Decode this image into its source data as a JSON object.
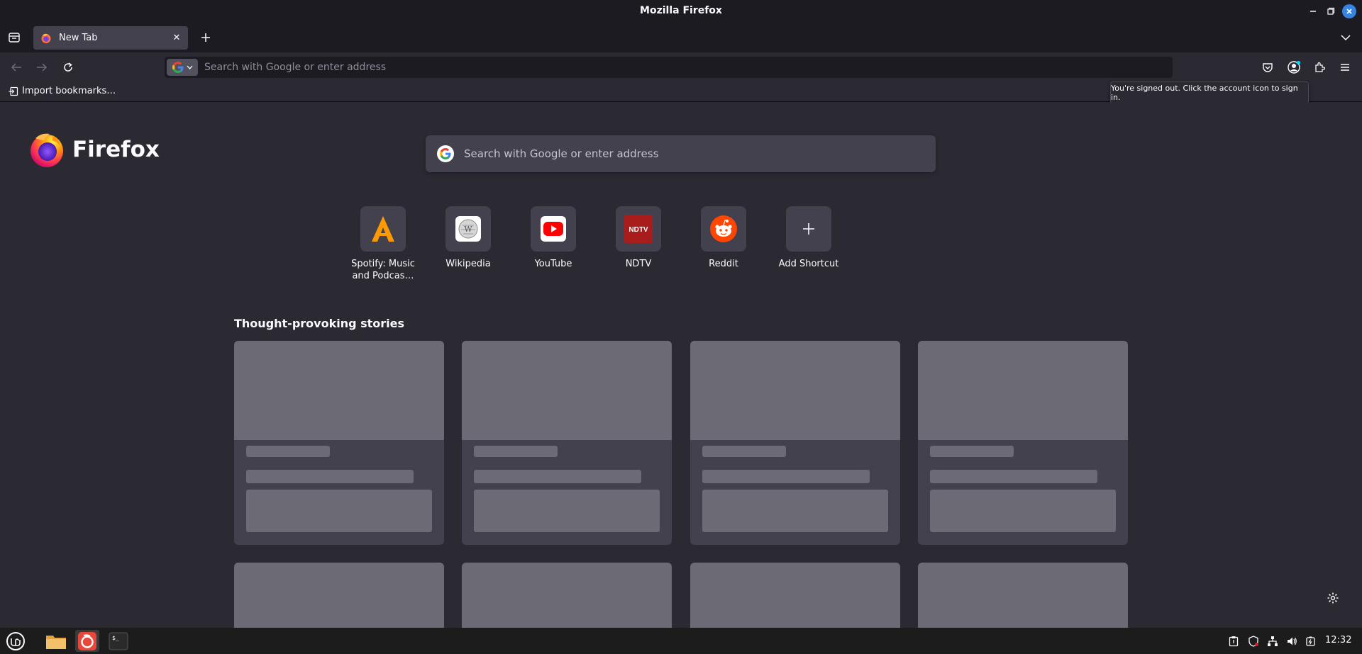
{
  "window": {
    "title": "Mozilla Firefox"
  },
  "tabs": [
    {
      "label": "New Tab",
      "close": "✕"
    }
  ],
  "urlbar": {
    "placeholder": "Search with Google or enter address"
  },
  "bookmarks_toolbar": {
    "import_label": "Import bookmarks…"
  },
  "tooltip": {
    "text": "You're signed out. Click the account icon to sign in."
  },
  "newtab": {
    "brand": "Firefox",
    "search_placeholder": "Search with Google or enter address",
    "shortcuts": [
      {
        "name": "Spotify: Music and Podcas…",
        "icon": "spotify-icon"
      },
      {
        "name": "Wikipedia",
        "icon": "wikipedia-icon"
      },
      {
        "name": "YouTube",
        "icon": "youtube-icon"
      },
      {
        "name": "NDTV",
        "icon": "ndtv-icon"
      },
      {
        "name": "Reddit",
        "icon": "reddit-icon"
      },
      {
        "name": "Add Shortcut",
        "icon": "plus-icon"
      }
    ],
    "stories_title": "Thought-provoking stories",
    "ndtv_badge": "NDTV"
  },
  "taskbar": {
    "clock": "12:32"
  },
  "colors": {
    "accent": "#3584e4",
    "background": "#2b2a33",
    "chrome": "#1c1b22",
    "card": "#42414d",
    "skeleton": "#6b6a75"
  }
}
